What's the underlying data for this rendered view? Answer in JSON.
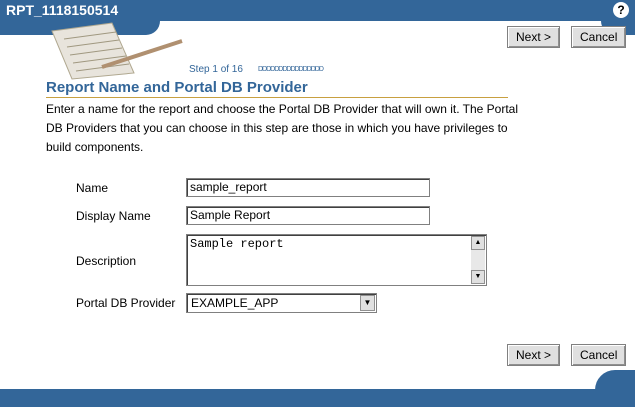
{
  "header": {
    "title": "RPT_1118150514",
    "help_icon": "question-mark-icon"
  },
  "buttons": {
    "next_label": "Next >",
    "cancel_label": "Cancel"
  },
  "step": {
    "label": "Step 1 of 16",
    "arrows": "DDDDDDDDDDDDDDDD"
  },
  "page": {
    "title": "Report Name and Portal DB Provider",
    "description": "Enter a name for the report and choose the Portal DB Provider that will own it. The Portal DB Providers that you can choose in this step are those in which you have privileges to build components."
  },
  "form": {
    "name_label": "Name",
    "name_value": "sample_report",
    "display_name_label": "Display Name",
    "display_name_value": "Sample Report",
    "description_label": "Description",
    "description_value": "Sample report",
    "provider_label": "Portal DB Provider",
    "provider_value": "EXAMPLE_APP"
  },
  "colors": {
    "brand": "#336699",
    "accent": "#c8a040"
  }
}
